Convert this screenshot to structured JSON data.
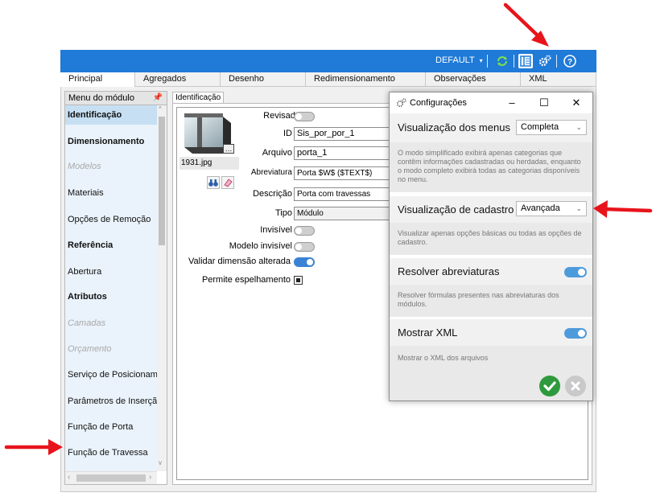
{
  "colors": {
    "titlebar": "#1f7ad8",
    "menu_active": "#c7dff2",
    "toggle_on": "#3a82d6",
    "annotation_arrow": "#e8141c",
    "confirm": "#2f9a3d",
    "cancel": "#c9c9c9"
  },
  "titlebar": {
    "profile": "DEFAULT",
    "icons": [
      "refresh-icon",
      "layout-icon",
      "settings-gears-icon",
      "help-icon"
    ]
  },
  "main_tabs": [
    "Principal",
    "Agregados",
    "Desenho",
    "Redimensionamento",
    "Observações",
    "XML"
  ],
  "side_menu": {
    "title": "Menu do módulo",
    "items": [
      {
        "label": "Identificação",
        "style": "bold-active"
      },
      {
        "label": "Dimensionamento",
        "style": "bold"
      },
      {
        "label": "Modelos",
        "style": "disabled"
      },
      {
        "label": "Materiais",
        "style": "normal"
      },
      {
        "label": "Opções de Remoção",
        "style": "normal"
      },
      {
        "label": "Referência",
        "style": "bold"
      },
      {
        "label": "Abertura",
        "style": "normal"
      },
      {
        "label": "Atributos",
        "style": "bold"
      },
      {
        "label": "Camadas",
        "style": "disabled"
      },
      {
        "label": "Orçamento",
        "style": "disabled"
      },
      {
        "label": "Serviço de Posicionamento",
        "style": "normal"
      },
      {
        "label": "Parâmetros de Inserção",
        "style": "normal"
      },
      {
        "label": "Função de Porta",
        "style": "normal"
      },
      {
        "label": "Função de Travessa",
        "style": "normal"
      }
    ]
  },
  "content": {
    "tab": "Identificação",
    "thumbnail_file": "1931.jpg",
    "fields": {
      "revisado_label": "Revisado",
      "id_label": "ID",
      "id_value": "Sis_por_por_1",
      "arquivo_label": "Arquivo",
      "arquivo_value": "porta_1",
      "abreviatura_label": "Abreviatura",
      "abreviatura_value": "Porta $W$ ($TEXT$)",
      "descricao_label": "Descrição",
      "descricao_value": "Porta com travessas",
      "tipo_label": "Tipo",
      "tipo_value": "Módulo",
      "invisivel_label": "Invisível",
      "modelo_invisivel_label": "Modelo invisível",
      "validar_label": "Validar dimensão alterada",
      "espelhamento_label": "Permite espelhamento"
    }
  },
  "config_dialog": {
    "title": "Configurações",
    "menus_label": "Visualização dos menus",
    "menus_value": "Completa",
    "menus_desc": "O modo simplificado exibirá apenas categorias que contêm informações cadastradas ou herdadas, enquanto o modo completo exibirá todas as categorias disponíveis no menu.",
    "cadastro_label": "Visualização de cadastro",
    "cadastro_value": "Avançada",
    "cadastro_desc": "Visualizar apenas opções básicas ou todas as opções de cadastro.",
    "abrev_label": "Resolver abreviaturas",
    "abrev_desc": "Resolver fórmulas presentes nas abreviaturas dos módulos.",
    "xml_label": "Mostrar XML",
    "xml_desc": "Mostrar o XML dos arquivos"
  }
}
